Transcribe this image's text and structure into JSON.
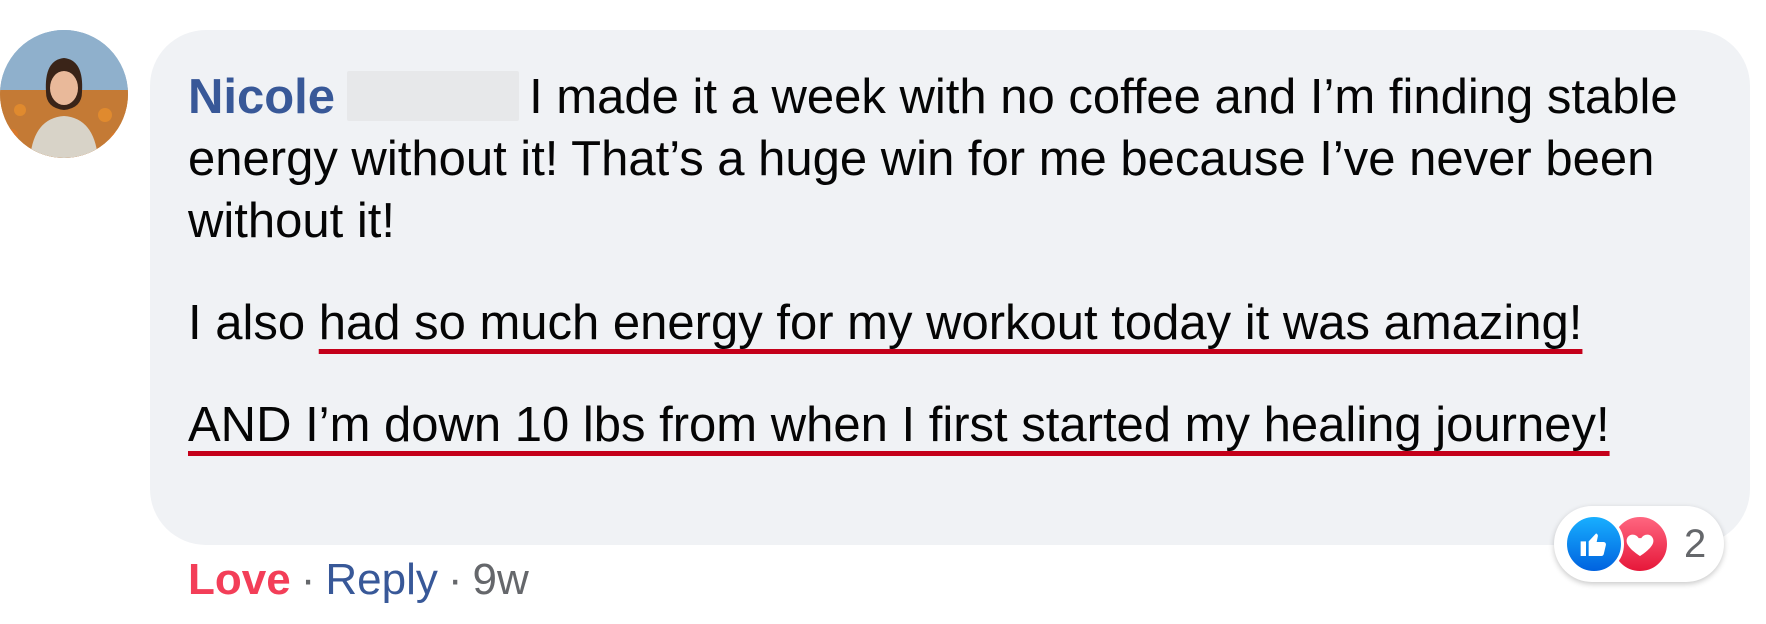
{
  "comment": {
    "author": "Nicole",
    "paragraphs": {
      "p1": "I made it a week with no coffee and I’m finding stable energy without it! That’s a huge win for me because I’ve never been without it!",
      "p2_plain": "I also ",
      "p2_underlined": "had so much energy for my workout today it was amazing!",
      "p3_underlined": "AND I’m down 10 lbs from when I first started my healing journey!"
    }
  },
  "actions": {
    "love_label": "Love",
    "separator": "·",
    "reply_label": "Reply",
    "timestamp": "9w"
  },
  "reactions": {
    "icons": [
      "like-icon",
      "love-icon"
    ],
    "count": "2"
  },
  "colors": {
    "author": "#385898",
    "love": "#f33e58",
    "underline": "#c4001a",
    "bubble": "#f0f2f5"
  }
}
